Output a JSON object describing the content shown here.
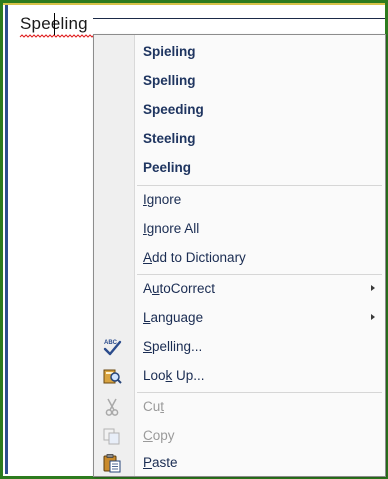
{
  "document": {
    "word": "Speeling"
  },
  "menu": {
    "suggestions": [
      "Spieling",
      "Spelling",
      "Speeding",
      "Steeling",
      "Peeling"
    ],
    "actions": {
      "ignore": {
        "pre": "",
        "key": "I",
        "post": "gnore"
      },
      "ignore_all": {
        "pre": "",
        "key": "I",
        "post": "gnore All"
      },
      "add_to_dictionary": {
        "pre": "",
        "key": "A",
        "post": "dd to Dictionary"
      },
      "autocorrect": {
        "pre": "A",
        "key": "u",
        "post": "toCorrect"
      },
      "language": {
        "pre": "",
        "key": "L",
        "post": "anguage"
      },
      "spelling": {
        "pre": "",
        "key": "S",
        "post": "pelling..."
      },
      "look_up": {
        "pre": "Loo",
        "key": "k",
        "post": " Up..."
      },
      "cut": {
        "pre": "Cu",
        "key": "t",
        "post": ""
      },
      "copy": {
        "pre": "",
        "key": "C",
        "post": "opy"
      },
      "paste": {
        "pre": "",
        "key": "P",
        "post": "aste"
      }
    },
    "icons": {
      "spelling": "spelling-check-icon",
      "look_up": "research-book-icon",
      "cut": "scissors-icon",
      "copy": "copy-icon",
      "paste": "clipboard-paste-icon",
      "submenu": "submenu-arrow-icon"
    }
  }
}
